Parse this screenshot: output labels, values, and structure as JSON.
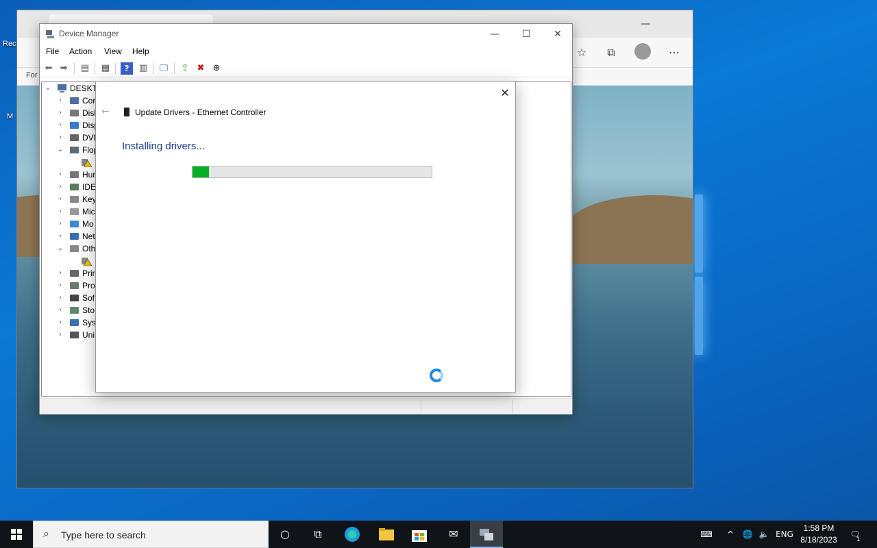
{
  "desktop": {
    "icon_labels": [
      "Rec",
      "M"
    ]
  },
  "browser": {
    "favorites_text": "For",
    "toolbar_icons": [
      "favorites-star-icon",
      "collections-icon",
      "profile-avatar",
      "more-menu-icon"
    ]
  },
  "device_manager": {
    "title": "Device Manager",
    "menu": [
      "File",
      "Action",
      "View",
      "Help"
    ],
    "toolbar_icons": [
      "back-arrow-icon",
      "forward-arrow-icon",
      "show-hide-console-tree-icon",
      "properties-icon",
      "help-icon",
      "view-icon",
      "scan-hardware-icon",
      "update-driver-icon",
      "uninstall-device-icon",
      "disable-device-icon"
    ],
    "tree": {
      "root": "DESKTO",
      "items": [
        {
          "label": "Cor",
          "chev": "›",
          "icon": "computer-icon"
        },
        {
          "label": "Disl",
          "chev": "›",
          "icon": "disk-drive-icon"
        },
        {
          "label": "Disp",
          "chev": "›",
          "icon": "display-adapter-icon"
        },
        {
          "label": "DVD",
          "chev": "›",
          "icon": "dvd-drive-icon"
        },
        {
          "label": "Flop",
          "chev": "⌄",
          "icon": "floppy-controller-icon"
        },
        {
          "label": "",
          "chev": "",
          "icon": "warning-device-icon",
          "child": true
        },
        {
          "label": "Hun",
          "chev": "›",
          "icon": "hid-icon"
        },
        {
          "label": "IDE",
          "chev": "›",
          "icon": "ide-controller-icon"
        },
        {
          "label": "Key",
          "chev": "›",
          "icon": "keyboard-icon"
        },
        {
          "label": "Mic",
          "chev": "›",
          "icon": "mouse-icon"
        },
        {
          "label": "Mo",
          "chev": "›",
          "icon": "monitor-icon"
        },
        {
          "label": "Net",
          "chev": "›",
          "icon": "network-adapter-icon"
        },
        {
          "label": "Oth",
          "chev": "⌄",
          "icon": "other-devices-icon"
        },
        {
          "label": "",
          "chev": "",
          "icon": "warning-device-icon",
          "child": true
        },
        {
          "label": "Prir",
          "chev": "›",
          "icon": "print-queue-icon"
        },
        {
          "label": "Pro",
          "chev": "›",
          "icon": "processor-icon"
        },
        {
          "label": "Sof",
          "chev": "›",
          "icon": "software-device-icon"
        },
        {
          "label": "Sto",
          "chev": "›",
          "icon": "storage-controller-icon"
        },
        {
          "label": "Syst",
          "chev": "›",
          "icon": "system-devices-icon"
        },
        {
          "label": "Uni",
          "chev": "›",
          "icon": "usb-controller-icon"
        }
      ]
    }
  },
  "dialog": {
    "title": "Update Drivers - Ethernet Controller",
    "heading": "Installing drivers...",
    "progress_fraction": 0.07,
    "close_symbol": "✕",
    "back_symbol": "←"
  },
  "taskbar": {
    "search_placeholder": "Type here to search",
    "apps": [
      "cortana-icon",
      "task-view-icon",
      "edge-icon",
      "file-explorer-icon",
      "store-icon",
      "mail-icon",
      "device-manager-taskbar-icon"
    ],
    "tray_language": "ENG",
    "time": "1:58 PM",
    "date": "8/18/2023",
    "notification_count": "1"
  },
  "colors": {
    "progress_green": "#06b025",
    "heading_blue": "#1e3f8c",
    "desktop_blue": "#0b79d6"
  }
}
